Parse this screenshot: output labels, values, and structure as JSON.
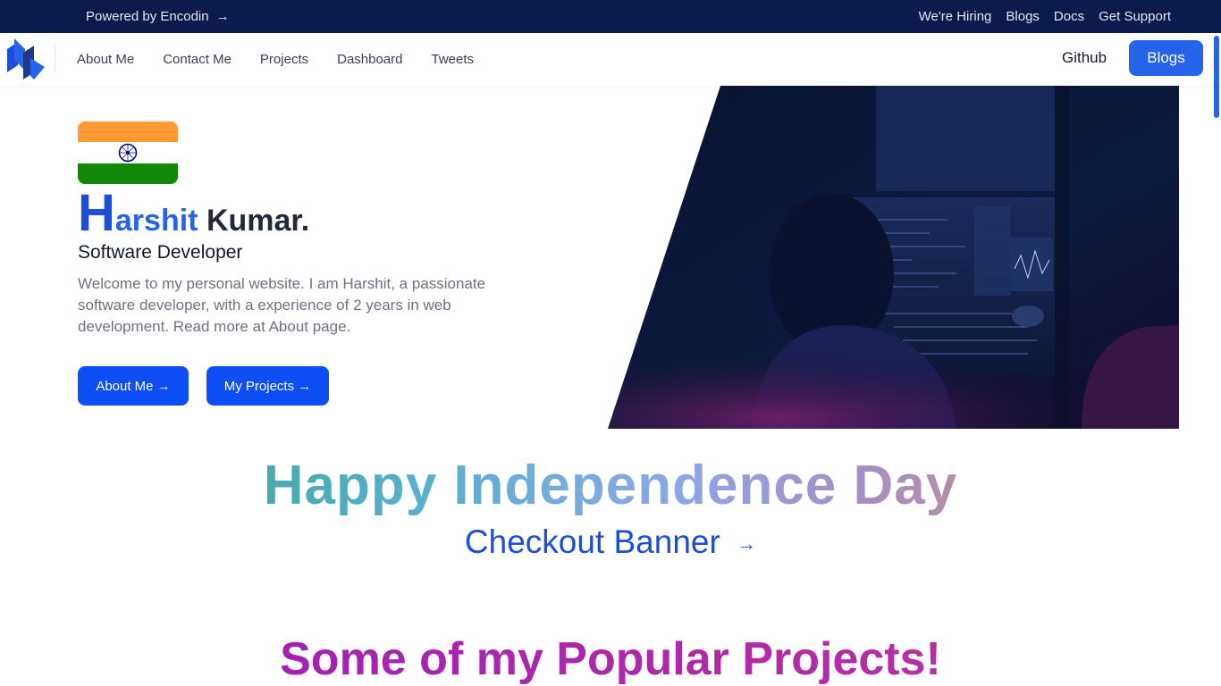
{
  "topbar": {
    "powered": "Powered by Encodin",
    "powered_arrow": "→",
    "links": [
      "We're Hiring",
      "Blogs",
      "Docs",
      "Get Support"
    ]
  },
  "nav": {
    "links": [
      "About Me",
      "Contact Me",
      "Projects",
      "Dashboard",
      "Tweets"
    ],
    "github": "Github",
    "blogs_button": "Blogs"
  },
  "hero": {
    "name_initial": "H",
    "name_rest_first": "arshit",
    "name_last": "Kumar.",
    "role": "Software Developer",
    "intro": "Welcome to my personal website. I am Harshit, a passionate software developer, with a experience of 2 years in web development. Read more at About page.",
    "about_button": "About Me →",
    "projects_button": "My Projects →"
  },
  "banner": {
    "title": "Happy Independence Day",
    "checkout": "Checkout Banner",
    "checkout_arrow": "→"
  },
  "section": {
    "popular_title": "Some of my Popular Projects!"
  },
  "colors": {
    "topbar_bg": "#0b1b4d",
    "accent": "#2563eb",
    "popular_gradient_start": "#9b1cb8"
  }
}
